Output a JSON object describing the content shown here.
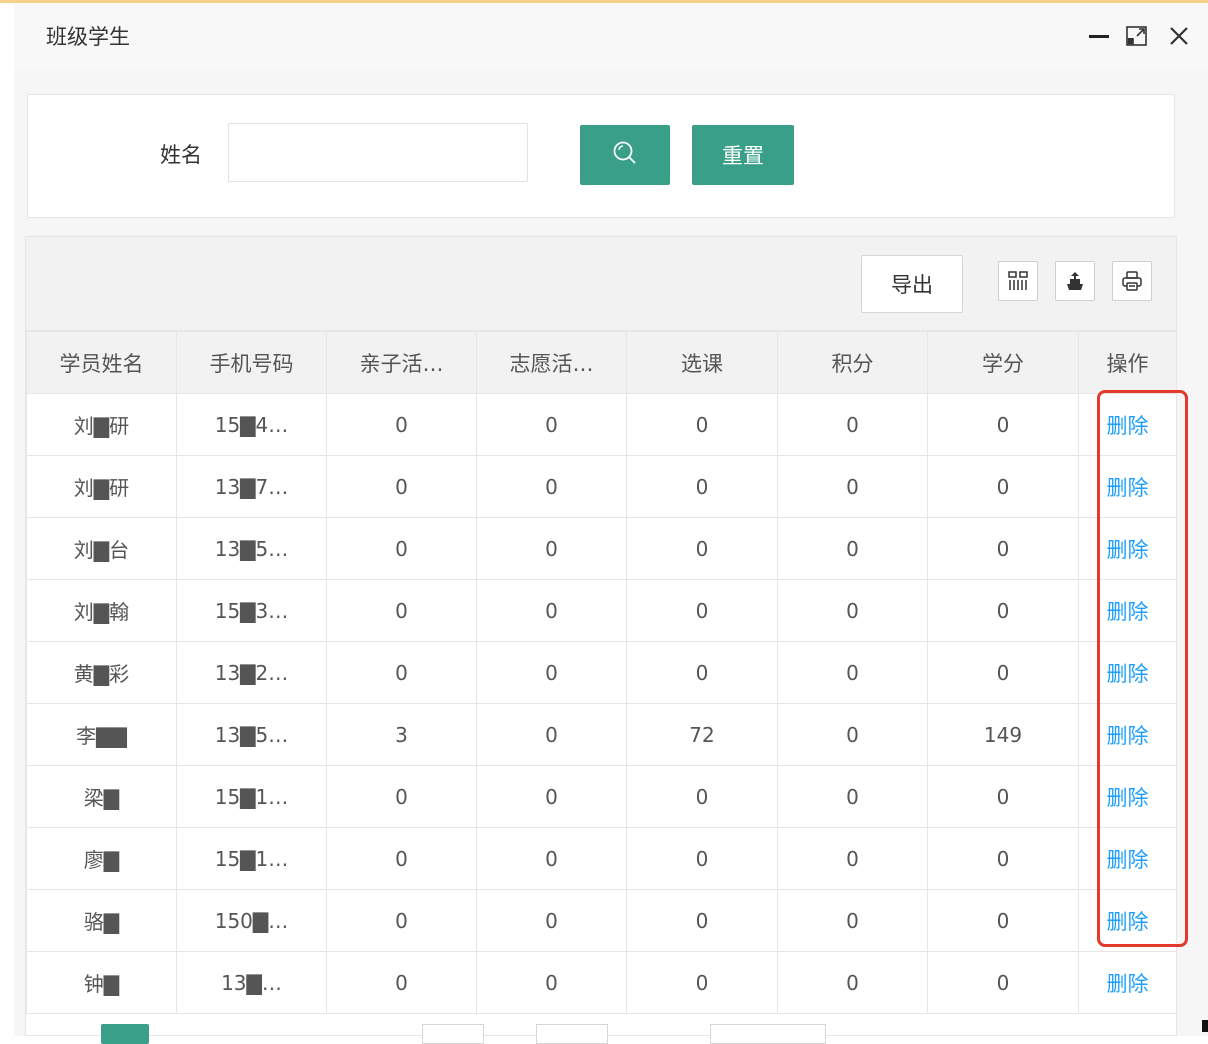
{
  "dialog": {
    "title": "班级学生",
    "controls": [
      "minimize-icon",
      "maximize-icon",
      "close-icon"
    ]
  },
  "search": {
    "label": "姓名",
    "value": "",
    "placeholder": "",
    "search_icon": "search-icon",
    "reset_label": "重置"
  },
  "toolbar": {
    "export_label": "导出",
    "icons": [
      "columns-icon",
      "export-icon",
      "print-icon"
    ]
  },
  "table": {
    "headers": [
      "学员姓名",
      "手机号码",
      "亲子活…",
      "志愿活…",
      "选课",
      "积分",
      "学分",
      "操作"
    ],
    "rows": [
      [
        "刘▇研",
        "15▇4…",
        "0",
        "0",
        "0",
        "0",
        "0",
        "删除"
      ],
      [
        "刘▇研",
        "13▇7…",
        "0",
        "0",
        "0",
        "0",
        "0",
        "删除"
      ],
      [
        "刘▇台",
        "13▇5…",
        "0",
        "0",
        "0",
        "0",
        "0",
        "删除"
      ],
      [
        "刘▇翰",
        "15▇3…",
        "0",
        "0",
        "0",
        "0",
        "0",
        "删除"
      ],
      [
        "黄▇彩",
        "13▇2…",
        "0",
        "0",
        "0",
        "0",
        "0",
        "删除"
      ],
      [
        "李▇▇",
        "13▇5…",
        "3",
        "0",
        "72",
        "0",
        "149",
        "删除"
      ],
      [
        "梁▇",
        "15▇1…",
        "0",
        "0",
        "0",
        "0",
        "0",
        "删除"
      ],
      [
        "廖▇",
        "15▇1…",
        "0",
        "0",
        "0",
        "0",
        "0",
        "删除"
      ],
      [
        "骆▇",
        "150▇…",
        "0",
        "0",
        "0",
        "0",
        "0",
        "删除"
      ],
      [
        "钟▇",
        "13▇…",
        "0",
        "0",
        "0",
        "0",
        "0",
        "删除"
      ]
    ]
  },
  "colors": {
    "accent": "#3a9f88",
    "link": "#1e9fff",
    "highlight": "#e23a2c"
  }
}
